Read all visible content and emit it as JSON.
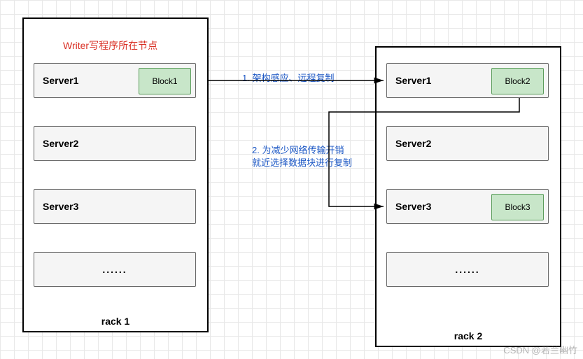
{
  "racks": {
    "left": {
      "label": "rack 1"
    },
    "right": {
      "label": "rack 2"
    }
  },
  "writer_label": "Writer写程序所在节点",
  "left_servers": {
    "s1": {
      "label": "Server1",
      "block": "Block1"
    },
    "s2": {
      "label": "Server2"
    },
    "s3": {
      "label": "Server3"
    },
    "s4": {
      "label": "......"
    }
  },
  "right_servers": {
    "s1": {
      "label": "Server1",
      "block": "Block2"
    },
    "s2": {
      "label": "Server2"
    },
    "s3": {
      "label": "Server3",
      "block": "Block3"
    },
    "s4": {
      "label": "......"
    }
  },
  "annotations": {
    "a1": "1. 架构感应、远程复制",
    "a2_line1": "2. 为减少网络传输开销",
    "a2_line2": "就近选择数据块进行复制"
  },
  "watermark": "CSDN @若兰幽竹"
}
